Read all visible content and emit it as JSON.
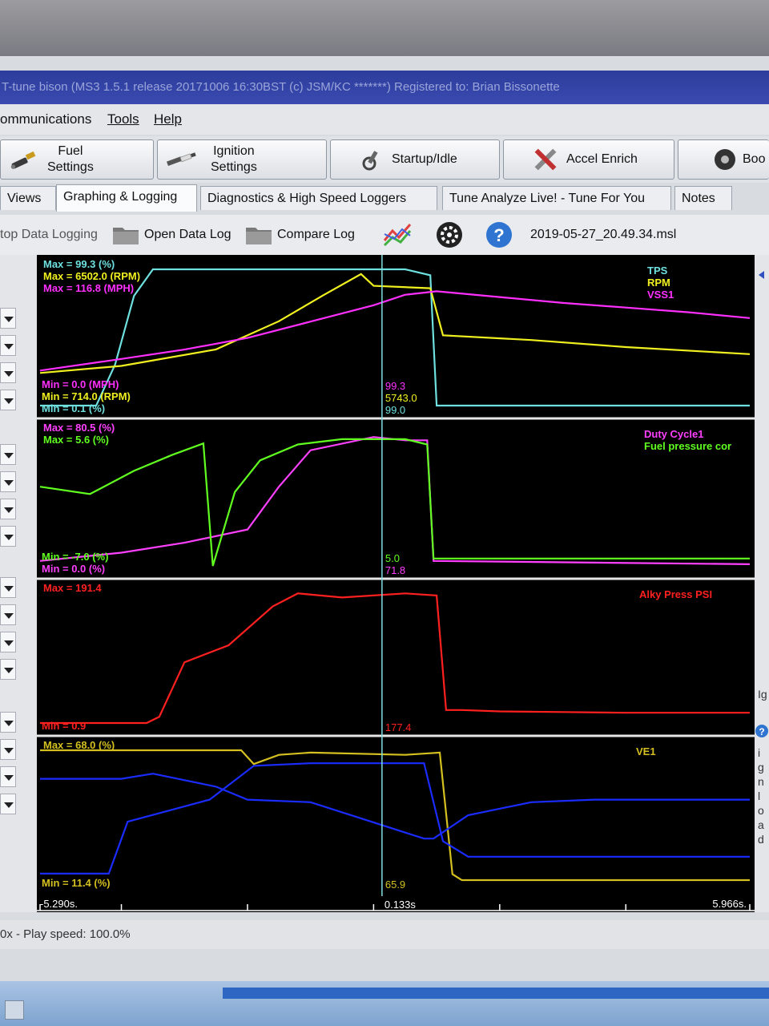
{
  "window": {
    "title": "T-tune bison (MS3 1.5.1 release   20171006 16:30BST (c) JSM/KC *******) Registered to: Brian Bissonette"
  },
  "menu": {
    "items": [
      "ommunications",
      "Tools",
      "Help"
    ]
  },
  "toolbar": {
    "buttons": [
      {
        "line1": "Fuel",
        "line2": "Settings",
        "icon": "injector-icon"
      },
      {
        "line1": "Ignition",
        "line2": "Settings",
        "icon": "spark-plug-icon"
      },
      {
        "line1": "Startup/Idle",
        "line2": "",
        "icon": "wrench-icon"
      },
      {
        "line1": "Accel Enrich",
        "line2": "",
        "icon": "tools-icon"
      },
      {
        "line1": "Boo",
        "line2": "",
        "icon": "turbo-icon"
      }
    ]
  },
  "tabs": [
    "Views",
    "Graphing & Logging",
    "Diagnostics & High Speed Loggers",
    "Tune Analyze Live! - Tune For You",
    "Notes"
  ],
  "active_tab": "Graphing & Logging",
  "logbar": {
    "stop": "top Data Logging",
    "open": "Open Data Log",
    "compare": "Compare Log",
    "filename": "2019-05-27_20.49.34.msl"
  },
  "right_strip": {
    "label1": "Ig",
    "vertical": [
      "i",
      "g",
      "n",
      "l",
      "o",
      "a",
      "d"
    ]
  },
  "status": {
    "text": "0x - Play speed: 100.0%"
  },
  "colors": {
    "background": "#000000",
    "divider": "#e6e6e6",
    "cursor": "#7fe0e0",
    "tps": "#6fe0e0",
    "rpm": "#f0f020",
    "vss": "#ff30ff",
    "duty": "#ff40ff",
    "fuelp": "#60ff20",
    "alky": "#ff2020",
    "ve": "#d4c020",
    "blue": "#1a2cff"
  },
  "chart_data": [
    {
      "type": "line",
      "panel": 1,
      "x_range": [
        -5.29,
        5.966
      ],
      "legend": [
        "TPS",
        "RPM",
        "VSS1"
      ],
      "max_labels": [
        "Max = 99.3 (%)",
        "Max = 6502.0 (RPM)",
        "Max = 116.8 (MPH)"
      ],
      "min_labels": [
        "Min = 0.0 (MPH)",
        "Min = 714.0 (RPM)",
        "Min = 0.1 (%)"
      ],
      "cursor_values": [
        "99.3",
        "5743.0",
        "99.0"
      ],
      "series": [
        {
          "name": "TPS",
          "unit": "%",
          "min": 0.1,
          "max": 99.3,
          "x": [
            -5.29,
            -4.4,
            -4.1,
            -3.8,
            -3.5,
            0.5,
            0.9,
            1.0,
            5.966
          ],
          "y": [
            0.1,
            0.1,
            30,
            80,
            99.3,
            99.3,
            95,
            0.1,
            0.1
          ]
        },
        {
          "name": "RPM",
          "unit": "RPM",
          "min": 714,
          "max": 6502,
          "x": [
            -5.29,
            -4.0,
            -2.5,
            -1.5,
            -0.8,
            -0.2,
            0.0,
            0.9,
            1.1,
            2.5,
            4.0,
            5.966
          ],
          "y": [
            2100,
            2400,
            3100,
            4300,
            5400,
            6300,
            5800,
            5700,
            3700,
            3500,
            3200,
            2900
          ]
        },
        {
          "name": "VSS1",
          "unit": "MPH",
          "min": 0.0,
          "max": 116.8,
          "x": [
            -5.29,
            -4.0,
            -3.0,
            -2.0,
            -1.0,
            0.0,
            0.5,
            1.0,
            2.0,
            3.0,
            4.0,
            5.0,
            5.966
          ],
          "y": [
            30,
            40,
            48,
            58,
            72,
            86,
            95,
            98,
            93,
            88,
            84,
            80,
            75
          ]
        }
      ]
    },
    {
      "type": "line",
      "panel": 2,
      "x_range": [
        -5.29,
        5.966
      ],
      "legend": [
        "Duty Cycle1",
        "Fuel pressure cor"
      ],
      "max_labels": [
        "Max = 80.5 (%)",
        "Max = 5.6 (%)"
      ],
      "min_labels": [
        "Min = -7.0 (%)",
        "Min = 0.0 (%)"
      ],
      "cursor_values": [
        "5.0",
        "71.8"
      ],
      "series": [
        {
          "name": "Duty Cycle1",
          "unit": "%",
          "min": 0.0,
          "max": 80.5,
          "x": [
            -5.29,
            -4.0,
            -3.0,
            -2.0,
            -1.5,
            -1.0,
            0.0,
            0.5,
            0.85,
            0.95,
            5.966
          ],
          "y": [
            3,
            8,
            14,
            22,
            48,
            70,
            78,
            76,
            76,
            3,
            1
          ]
        },
        {
          "name": "Fuel pressure cor",
          "unit": "%",
          "min": -7.0,
          "max": 5.6,
          "x": [
            -5.29,
            -4.5,
            -3.8,
            -3.2,
            -2.7,
            -2.55,
            -2.2,
            -1.8,
            -1.2,
            -0.5,
            0.5,
            0.85,
            0.95,
            5.966
          ],
          "y": [
            0.5,
            -0.2,
            2,
            3.5,
            4.6,
            -7.0,
            0,
            3,
            4.5,
            5.0,
            5.0,
            4.5,
            -6.3,
            -6.3
          ]
        }
      ]
    },
    {
      "type": "line",
      "panel": 3,
      "x_range": [
        -5.29,
        5.966
      ],
      "legend": [
        "Alky Press PSI"
      ],
      "max_labels": [
        "Max = 191.4"
      ],
      "min_labels": [
        "Min = 0.9"
      ],
      "cursor_values": [
        "177.4"
      ],
      "series": [
        {
          "name": "Alky Press PSI",
          "min": 0.9,
          "max": 191.4,
          "x": [
            -5.29,
            -3.6,
            -3.4,
            -3.0,
            -2.3,
            -1.6,
            -1.2,
            -0.5,
            0.5,
            1.0,
            1.15,
            1.4,
            2.0,
            3.0,
            4.0,
            5.966
          ],
          "y": [
            0.9,
            0.9,
            10,
            90,
            115,
            172,
            191,
            185,
            191,
            188,
            20,
            20,
            18,
            17,
            16,
            16
          ]
        }
      ]
    },
    {
      "type": "line",
      "panel": 4,
      "x_range": [
        -5.29,
        5.966
      ],
      "legend": [
        "VE1"
      ],
      "max_labels": [
        "Max = 68.0 (%)"
      ],
      "min_labels": [
        "Min = 11.4 (%)"
      ],
      "cursor_values": [
        "65.9"
      ],
      "series": [
        {
          "name": "VE1",
          "unit": "%",
          "min": 11.4,
          "max": 68.0,
          "x": [
            -5.29,
            -2.1,
            -1.9,
            -1.5,
            -1.0,
            0.5,
            1.05,
            1.25,
            1.4,
            3.0,
            5.966
          ],
          "y": [
            68,
            68,
            62,
            66,
            67,
            66,
            67,
            14,
            11.4,
            11.4,
            11.4
          ]
        }
      ]
    }
  ],
  "time_axis": {
    "start": "-5.290s.",
    "cursor": "0.133s",
    "end": "5.966s."
  }
}
